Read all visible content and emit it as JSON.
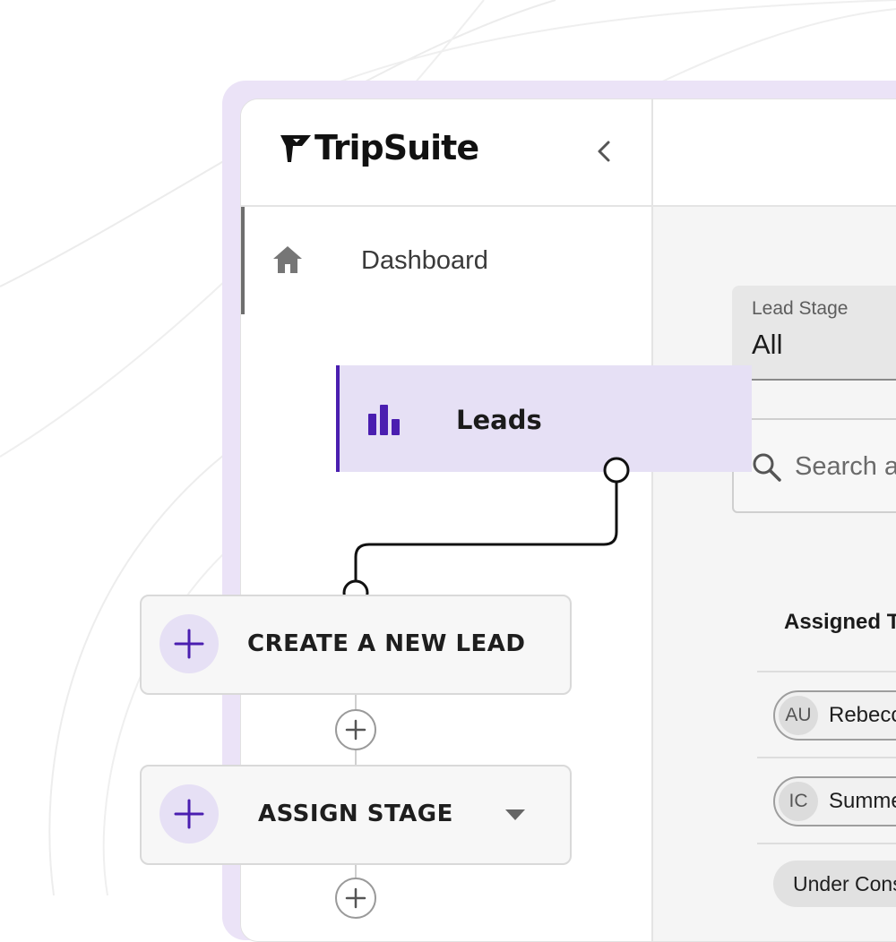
{
  "brand": {
    "name": "TripSuite"
  },
  "sidebar": {
    "items": [
      {
        "label": "Dashboard",
        "icon": "home-icon"
      },
      {
        "label": "Leads",
        "icon": "bar-chart-icon"
      }
    ]
  },
  "filters": {
    "lead_stage": {
      "label": "Lead Stage",
      "value": "All"
    },
    "search": {
      "placeholder": "Search a"
    }
  },
  "table": {
    "column_header": "Assigned T",
    "rows": [
      {
        "initials": "AU",
        "name": "Rebecc"
      },
      {
        "initials": "IC",
        "name": "Summe"
      }
    ],
    "status_chip": "Under Cons"
  },
  "workflow": {
    "steps": [
      {
        "label": "CREATE A NEW LEAD",
        "icon": "plus-icon"
      },
      {
        "label": "ASSIGN STAGE",
        "icon": "plus-icon",
        "has_dropdown": true
      }
    ]
  },
  "colors": {
    "accent": "#4a1eb0",
    "highlight": "#e6e0f5",
    "frame": "#ebe3f7"
  }
}
